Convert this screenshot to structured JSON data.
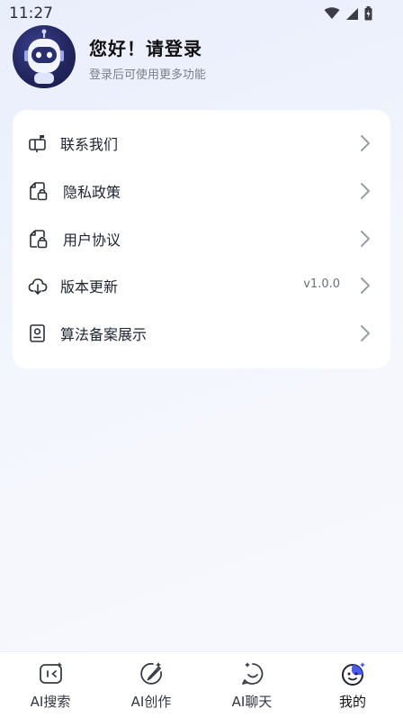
{
  "status_bar": {
    "time": "11:27"
  },
  "header": {
    "title": "您好！请登录",
    "subtitle": "登录后可使用更多功能"
  },
  "menu": {
    "items": [
      {
        "label": "联系我们",
        "icon": "mailbox-icon",
        "value": ""
      },
      {
        "label": "隐私政策",
        "icon": "document-lock-icon",
        "value": ""
      },
      {
        "label": "用户协议",
        "icon": "document-lock-icon",
        "value": ""
      },
      {
        "label": "版本更新",
        "icon": "cloud-download-icon",
        "value": "v1.0.0"
      },
      {
        "label": "算法备案展示",
        "icon": "id-card-icon",
        "value": ""
      }
    ]
  },
  "tabbar": {
    "tabs": [
      {
        "label": "AI搜索",
        "icon": "ai-search-icon",
        "active": false
      },
      {
        "label": "AI创作",
        "icon": "ai-create-icon",
        "active": false
      },
      {
        "label": "AI聊天",
        "icon": "ai-chat-icon",
        "active": false
      },
      {
        "label": "我的",
        "icon": "profile-face-icon",
        "active": true
      }
    ]
  },
  "colors": {
    "accent": "#4a5cf0",
    "card": "#ffffff",
    "text": "#1f2330",
    "muted": "#7b7f8a"
  }
}
